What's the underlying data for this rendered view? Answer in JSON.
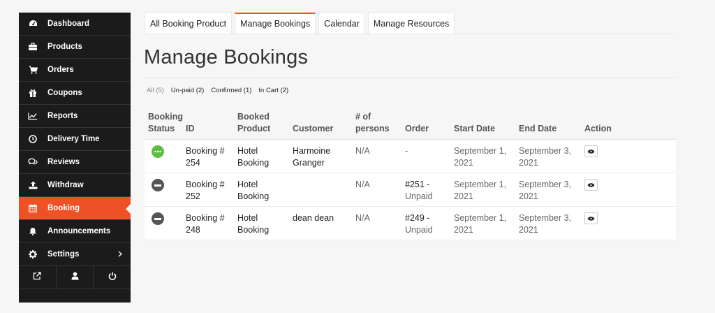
{
  "sidebar": {
    "items": [
      {
        "label": "Dashboard",
        "icon": "dashboard-icon"
      },
      {
        "label": "Products",
        "icon": "briefcase-icon"
      },
      {
        "label": "Orders",
        "icon": "cart-icon"
      },
      {
        "label": "Coupons",
        "icon": "gift-icon"
      },
      {
        "label": "Reports",
        "icon": "chart-icon"
      },
      {
        "label": "Delivery Time",
        "icon": "clock-icon"
      },
      {
        "label": "Reviews",
        "icon": "comments-icon"
      },
      {
        "label": "Withdraw",
        "icon": "upload-icon"
      },
      {
        "label": "Booking",
        "icon": "calendar-icon",
        "active": true
      },
      {
        "label": "Announcements",
        "icon": "bell-icon"
      },
      {
        "label": "Settings",
        "icon": "gear-icon"
      }
    ],
    "bottom": [
      "external-link-icon",
      "user-icon",
      "power-icon"
    ],
    "active_color": "#f05025"
  },
  "tabs": [
    {
      "label": "All Booking Product"
    },
    {
      "label": "Manage Bookings",
      "active": true
    },
    {
      "label": "Calendar"
    },
    {
      "label": "Manage Resources"
    }
  ],
  "title": "Manage Bookings",
  "filters": {
    "all": "All (5)",
    "unpaid": "Un-paid (2)",
    "confirmed": "Confirmed (1)",
    "in_cart": "In Cart (2)"
  },
  "table": {
    "headers": {
      "status_line1": "Booking",
      "status_line2": "Status",
      "id": "ID",
      "product_line1": "Booked",
      "product_line2": "Product",
      "customer": "Customer",
      "persons_line1": "# of",
      "persons_line2": "persons",
      "order": "Order",
      "start": "Start Date",
      "end": "End Date",
      "action": "Action"
    },
    "rows": [
      {
        "status": "unpaid",
        "status_color": "#5fbd46",
        "id_line1": "Booking #",
        "id_line2": "254",
        "product_line1": "Hotel",
        "product_line2": "Booking",
        "customer_line1": "Harmoine",
        "customer_line2": "Granger",
        "persons": "N/A",
        "order_line1": "-",
        "order_line2": "",
        "start_line1": "September 1,",
        "start_line2": "2021",
        "end_line1": "September 3,",
        "end_line2": "2021"
      },
      {
        "status": "cancelled",
        "status_color": "#555555",
        "id_line1": "Booking #",
        "id_line2": "252",
        "product_line1": "Hotel",
        "product_line2": "Booking",
        "customer_line1": "",
        "customer_line2": "",
        "persons": "N/A",
        "order_line1": "#251 -",
        "order_line2": "Unpaid",
        "start_line1": "September 1,",
        "start_line2": "2021",
        "end_line1": "September 3,",
        "end_line2": "2021"
      },
      {
        "status": "cancelled",
        "status_color": "#555555",
        "id_line1": "Booking #",
        "id_line2": "248",
        "product_line1": "Hotel",
        "product_line2": "Booking",
        "customer_line1": "dean dean",
        "customer_line2": "",
        "persons": "N/A",
        "order_line1": "#249 -",
        "order_line2": "Unpaid",
        "start_line1": "September 1,",
        "start_line2": "2021",
        "end_line1": "September 3,",
        "end_line2": "2021"
      }
    ]
  }
}
